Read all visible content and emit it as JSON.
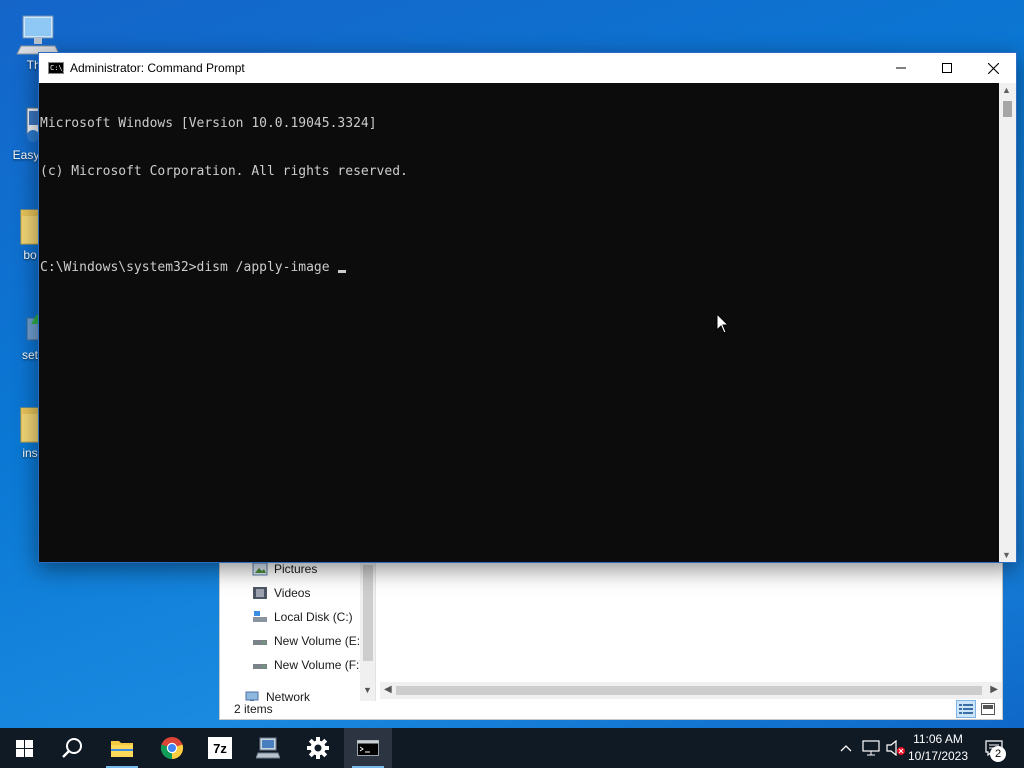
{
  "desktop": {
    "icons": [
      {
        "label": "This",
        "icon": "monitor-icon"
      },
      {
        "label": "EasyB",
        "icon": "app-icon"
      },
      {
        "label": "bo",
        "icon": "folder-icon"
      },
      {
        "label": "set",
        "icon": "setup-icon"
      },
      {
        "label": "ins",
        "icon": "folder-icon"
      }
    ]
  },
  "cmd": {
    "title": "Administrator: Command Prompt",
    "icon_text": "C:\\_",
    "lines": [
      "Microsoft Windows [Version 10.0.19045.3324]",
      "(c) Microsoft Corporation. All rights reserved.",
      "",
      "C:\\Windows\\system32>dism /apply-image "
    ],
    "controls": {
      "minimize": "minimize-icon",
      "maximize": "maximize-icon",
      "close": "close-icon"
    }
  },
  "explorer": {
    "nav_items": [
      {
        "label": "Pictures",
        "icon": "pictures-icon"
      },
      {
        "label": "Videos",
        "icon": "videos-icon"
      },
      {
        "label": "Local Disk (C:)",
        "icon": "disk-icon"
      },
      {
        "label": "New Volume (E:)",
        "icon": "drive-icon"
      },
      {
        "label": "New Volume (F:)",
        "icon": "drive-icon"
      },
      {
        "label": "Network",
        "icon": "network-icon"
      }
    ],
    "status": "2 items"
  },
  "taskbar": {
    "apps": [
      {
        "name": "start",
        "icon": "windows-logo-icon"
      },
      {
        "name": "search",
        "icon": "search-icon"
      },
      {
        "name": "file-explorer",
        "icon": "folder-icon"
      },
      {
        "name": "chrome",
        "icon": "chrome-icon"
      },
      {
        "name": "7zip",
        "icon": "7zip-icon",
        "text": "7z"
      },
      {
        "name": "network-tool",
        "icon": "computer-icon"
      },
      {
        "name": "settings",
        "icon": "gear-icon"
      },
      {
        "name": "command-prompt",
        "icon": "terminal-icon"
      }
    ],
    "tray": {
      "time": "11:06 AM",
      "date": "10/17/2023",
      "notification_count": "2"
    }
  },
  "colors": {
    "desktop_accent": "#0a78d4",
    "taskbar": "#101a25",
    "console_bg": "#0c0c0c",
    "console_fg": "#cccccc"
  }
}
